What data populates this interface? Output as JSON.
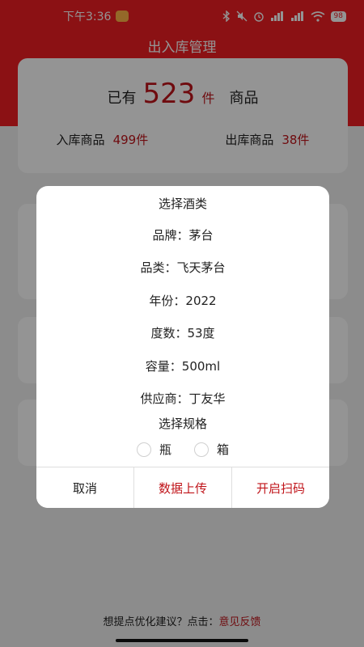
{
  "status_bar": {
    "time": "下午3:36",
    "battery": "98"
  },
  "header": {
    "title": "出入库管理"
  },
  "summary": {
    "prefix": "已有",
    "total": "523",
    "total_unit": "件",
    "suffix": "商品",
    "inbound_label": "入库商品",
    "inbound_value": "499件",
    "outbound_label": "出库商品",
    "outbound_value": "38件"
  },
  "footer": {
    "text": "想提点优化建议？点击：",
    "link": "意见反馈"
  },
  "dialog": {
    "title": "选择酒类",
    "fields": [
      {
        "label": "品牌：",
        "value": "茅台"
      },
      {
        "label": "品类：",
        "value": "飞天茅台"
      },
      {
        "label": "年份：",
        "value": "2022"
      },
      {
        "label": "度数：",
        "value": "53度"
      },
      {
        "label": "容量：",
        "value": "500ml"
      },
      {
        "label": "供应商：",
        "value": "丁友华"
      }
    ],
    "spec_title": "选择规格",
    "options": [
      "瓶",
      "箱"
    ],
    "buttons": {
      "cancel": "取消",
      "upload": "数据上传",
      "scan": "开启扫码"
    }
  },
  "colors": {
    "brand_red": "#f01e24",
    "accent_red": "#c0141a"
  }
}
